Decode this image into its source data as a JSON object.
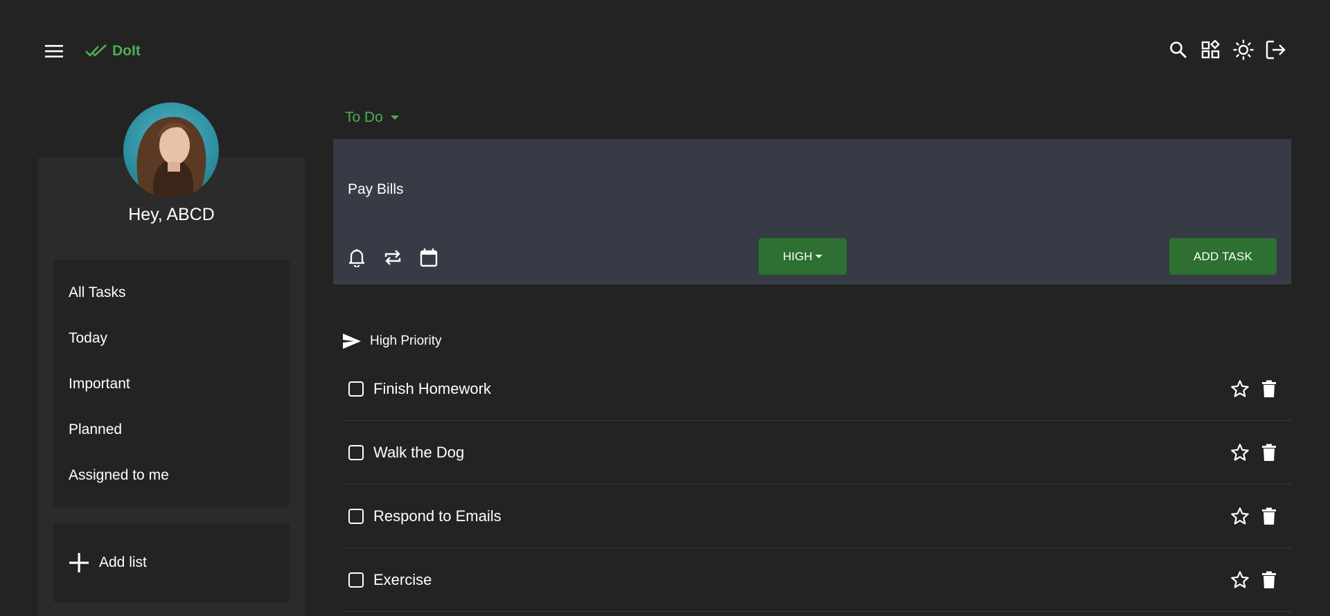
{
  "app": {
    "brand": "DoIt",
    "brand_color": "#4caf50",
    "accent": "#2e7032",
    "icons": {
      "menu": "menu-icon",
      "logo": "double-check-icon",
      "search": "search-icon",
      "apps": "widgets-icon",
      "theme": "sun-icon",
      "logout": "logout-icon"
    }
  },
  "sidebar": {
    "greeting": "Hey, ABCD",
    "items": [
      {
        "label": "All Tasks"
      },
      {
        "label": "Today"
      },
      {
        "label": "Important"
      },
      {
        "label": "Planned"
      },
      {
        "label": "Assigned to me"
      }
    ],
    "add_list_label": "Add list"
  },
  "main": {
    "list_name": "To Do",
    "composer": {
      "value": "Pay Bills",
      "priority_label": "HIGH",
      "add_button_label": "ADD TASK",
      "icons": [
        "bell-icon",
        "repeat-icon",
        "calendar-icon"
      ]
    },
    "section": {
      "title": "High Priority"
    },
    "tasks": [
      {
        "title": "Finish Homework",
        "checked": false,
        "starred": false
      },
      {
        "title": "Walk the Dog",
        "checked": false,
        "starred": false
      },
      {
        "title": "Respond to Emails",
        "checked": false,
        "starred": false
      },
      {
        "title": "Exercise",
        "checked": false,
        "starred": false
      }
    ]
  }
}
